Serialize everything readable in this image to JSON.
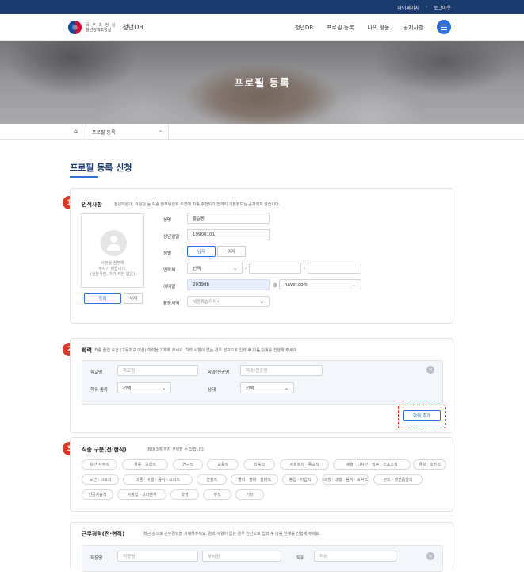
{
  "topbar": {
    "mypage": "마이페이지",
    "sep": "·",
    "logout": "로그아웃"
  },
  "logo": {
    "org_line1": "국 무 조 정 실",
    "org_line2": "청년정책조정실",
    "site": "청년DB"
  },
  "gnb": [
    "청년DB",
    "프로필 등록",
    "나의 활동",
    "공지사항"
  ],
  "hero": {
    "title": "프로필 등록"
  },
  "breadcrumb": {
    "current": "프로필 등록"
  },
  "page_title": "프로필 등록 신청",
  "section1": {
    "num": "1",
    "title": "인적사항",
    "desc": "청년지원대, 자문단 등 각종 정부위원회 추천에 최종 추천되기 전까지 기본정보는 공개되지 않습니다.",
    "photo_note_1": "사진을 첨부해",
    "photo_note_2": "주시기 바랍니다.",
    "photo_note_3": "(신분사진, 가기 제한 없음)",
    "register_btn": "등록",
    "delete_btn": "삭제",
    "name_label": "성명",
    "name_value": "홍길동",
    "birth_label": "생년월일",
    "birth_value": "19900101",
    "gender_label": "성별",
    "gender_male": "남자",
    "gender_female": "여자",
    "phone_label": "연락처",
    "phone_select": "선택",
    "phone_dash": "-",
    "email_label": "이메일",
    "email_value": "2039db",
    "email_at": "@",
    "email_domain": "naver.com",
    "region_label": "활동지역",
    "region_value": "세종특별자치시"
  },
  "section2": {
    "num": "2",
    "title": "학력",
    "desc": "최종 졸업 요건 (고등학교 이상) 학력을 기재해 주세요. 학력 사항이 없는 경우 발표으로 입력 후 다음 단계를 진행해 주세요.",
    "school_label": "학교명",
    "school_ph": "학교명",
    "major_label": "학과/전공명",
    "major_ph": "학과/전공명",
    "degree_label": "학위 종류",
    "degree_value": "선택",
    "status_label": "상태",
    "status_value": "선택",
    "add_btn": "학력 추가"
  },
  "section3": {
    "num": "3",
    "title": "직종 구분(전·현직)",
    "desc": "최대 3개 까지 선택할 수 있습니다.",
    "chips": [
      "일반 사무직",
      "금융 · 보험직",
      "연구직",
      "교육직",
      "법률직",
      "사회복지 · 종교직",
      "예술 · 디자인 · 방송 · 스포츠직",
      "경찰 · 소방직",
      "보건 · 의료직",
      "미용 · 여행 · 음식 · 요리직",
      "건설직",
      "물리 · 정비 · 설비직",
      "농업 · 어업직",
      "미생 · 대행 · 음식 · 숙박직",
      "관리 · 생산품질직",
      "인공지능직",
      "자영업 · 프리랜서",
      "학생",
      "무직",
      "기타"
    ]
  },
  "section4": {
    "title": "근무경력(전·현직)",
    "desc": "최근 순으로 근무경력을 기재해주세요. 경력 사항이 없는 경우 빈칸으로 입력 후 다음 단계를 진행해 주세요.",
    "company_label": "직장명",
    "company_ph": "직장명",
    "dept_ph": "부서명",
    "position_label": "직위",
    "position_ph": "직위"
  },
  "colors": {
    "navy": "#1b3a6e",
    "blue": "#2f6fd9",
    "red": "#e6321e"
  }
}
